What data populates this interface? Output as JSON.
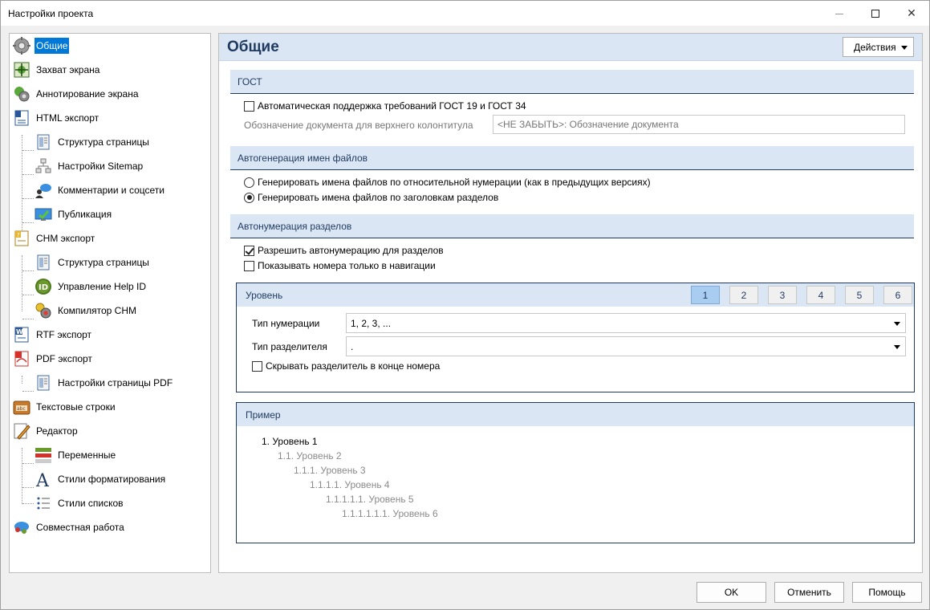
{
  "window": {
    "title": "Настройки проекта"
  },
  "sidebar": {
    "items": [
      {
        "label": "Общие",
        "icon": "gear-icon",
        "selected": true
      },
      {
        "label": "Захват экрана",
        "icon": "screen-capture-icon"
      },
      {
        "label": "Аннотирование экрана",
        "icon": "annotation-icon"
      },
      {
        "label": "HTML экспорт",
        "icon": "html-export-icon"
      },
      {
        "label": "Структура страницы",
        "icon": "page-structure-icon"
      },
      {
        "label": "Настройки Sitemap",
        "icon": "sitemap-icon"
      },
      {
        "label": "Комментарии и соцсети",
        "icon": "comments-icon"
      },
      {
        "label": "Публикация",
        "icon": "publish-icon"
      },
      {
        "label": "CHM экспорт",
        "icon": "chm-export-icon"
      },
      {
        "label": "Структура страницы",
        "icon": "page-structure-icon"
      },
      {
        "label": "Управление Help ID",
        "icon": "help-id-icon"
      },
      {
        "label": "Компилятор CHM",
        "icon": "compiler-icon"
      },
      {
        "label": "RTF экспорт",
        "icon": "rtf-export-icon"
      },
      {
        "label": "PDF экспорт",
        "icon": "pdf-export-icon"
      },
      {
        "label": "Настройки страницы PDF",
        "icon": "pdf-page-settings-icon"
      },
      {
        "label": "Текстовые строки",
        "icon": "text-strings-icon"
      },
      {
        "label": "Редактор",
        "icon": "editor-icon"
      },
      {
        "label": "Переменные",
        "icon": "variables-icon"
      },
      {
        "label": "Стили форматирования",
        "icon": "formatting-styles-icon"
      },
      {
        "label": "Стили списков",
        "icon": "list-styles-icon"
      },
      {
        "label": "Совместная работа",
        "icon": "collaboration-icon"
      }
    ]
  },
  "main": {
    "title": "Общие",
    "actions_label": "Действия",
    "gost": {
      "header": "ГОСТ",
      "auto_support_label": "Автоматическая поддержка требований ГОСТ 19 и ГОСТ 34",
      "auto_support_checked": false,
      "doc_designation_label": "Обозначение документа для верхнего колонтитула",
      "doc_designation_value": "<НЕ ЗАБЫТЬ>: Обозначение документа"
    },
    "filenames": {
      "header": "Автогенерация имен файлов",
      "option_numbering": "Генерировать имена файлов по относительной нумерации (как в предыдущих версиях)",
      "option_headings": "Генерировать имена файлов по заголовкам разделов",
      "selected": "headings"
    },
    "autonumber": {
      "header": "Автонумерация разделов",
      "allow_label": "Разрешить автонумерацию для разделов",
      "allow_checked": true,
      "nav_only_label": "Показывать номера только в навигации",
      "nav_only_checked": false
    },
    "level": {
      "header": "Уровень",
      "buttons": [
        "1",
        "2",
        "3",
        "4",
        "5",
        "6"
      ],
      "active": "1",
      "numbering_type_label": "Тип нумерации",
      "numbering_type_value": "1, 2, 3, ...",
      "separator_type_label": "Тип разделителя",
      "separator_type_value": ".",
      "hide_separator_label": "Скрывать разделитель в конце номера",
      "hide_separator_checked": false
    },
    "example": {
      "header": "Пример",
      "lines": [
        "1. Уровень 1",
        "1.1. Уровень 2",
        "1.1.1. Уровень 3",
        "1.1.1.1. Уровень 4",
        "1.1.1.1.1. Уровень 5",
        "1.1.1.1.1.1. Уровень 6"
      ]
    }
  },
  "footer": {
    "ok_label": "OK",
    "cancel_label": "Отменить",
    "help_label": "Помощь"
  },
  "colors": {
    "accent": "#0078d7",
    "section_bg": "#dbe6f4",
    "section_text": "#1e3a5f",
    "active_level": "#a9cdf0"
  }
}
